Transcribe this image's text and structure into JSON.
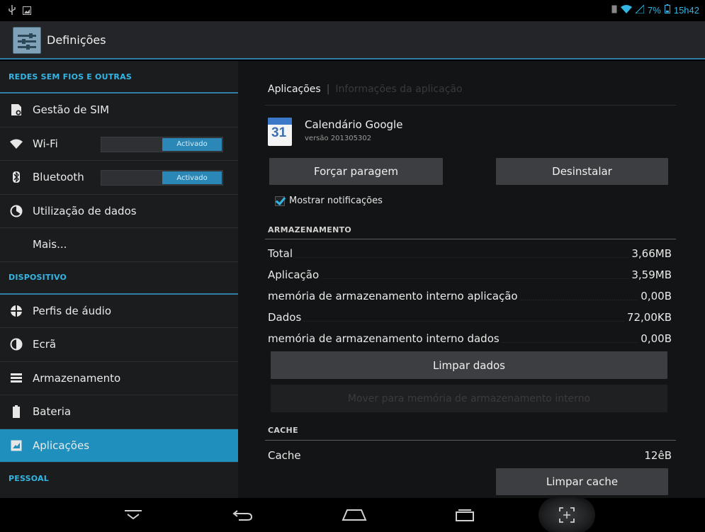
{
  "status_bar": {
    "battery_text": "7%",
    "time": "15h42"
  },
  "action_bar": {
    "title": "Definições"
  },
  "sidebar": {
    "sections": [
      {
        "header": "REDES SEM FIOS E OUTRAS"
      },
      {
        "header": "DISPOSITIVO"
      },
      {
        "header": "PESSOAL"
      }
    ],
    "items": [
      {
        "label": "Gestão de SIM",
        "icon": "sim-icon"
      },
      {
        "label": "Wi-Fi",
        "icon": "wifi-icon",
        "toggle": "Activado"
      },
      {
        "label": "Bluetooth",
        "icon": "bluetooth-icon",
        "toggle": "Activado"
      },
      {
        "label": "Utilização de dados",
        "icon": "data-usage-icon"
      },
      {
        "label": "Mais..."
      },
      {
        "label": "Perfis de áudio",
        "icon": "audio-profiles-icon"
      },
      {
        "label": "Ecrã",
        "icon": "display-icon"
      },
      {
        "label": "Armazenamento",
        "icon": "storage-icon"
      },
      {
        "label": "Bateria",
        "icon": "battery-icon"
      },
      {
        "label": "Aplicações",
        "icon": "apps-icon",
        "selected": true
      }
    ]
  },
  "main": {
    "breadcrumb": {
      "current": "Aplicações",
      "next": "Informações da aplicação"
    },
    "app": {
      "name": "Calendário Google",
      "version": "versão 201305302",
      "icon_number": "31"
    },
    "buttons": {
      "force_stop": "Forçar paragem",
      "uninstall": "Desinstalar",
      "clear_data": "Limpar dados",
      "move": "Mover para memória de armazenamento interno",
      "clear_cache": "Limpar cache"
    },
    "show_notifications": "Mostrar notificações",
    "storage": {
      "header": "ARMAZENAMENTO",
      "rows": [
        {
          "label": "Total",
          "value": "3,66MB"
        },
        {
          "label": "Aplicação",
          "value": "3,59MB"
        },
        {
          "label": "memória de armazenamento interno aplicação",
          "value": "0,00B"
        },
        {
          "label": "Dados",
          "value": "72,00KB"
        },
        {
          "label": "memória de armazenamento interno dados",
          "value": "0,00B"
        }
      ]
    },
    "cache": {
      "header": "CACHE",
      "label": "Cache",
      "value": "12êB"
    }
  },
  "colors": {
    "accent": "#33b5e5",
    "selected": "#1f8fbd"
  }
}
